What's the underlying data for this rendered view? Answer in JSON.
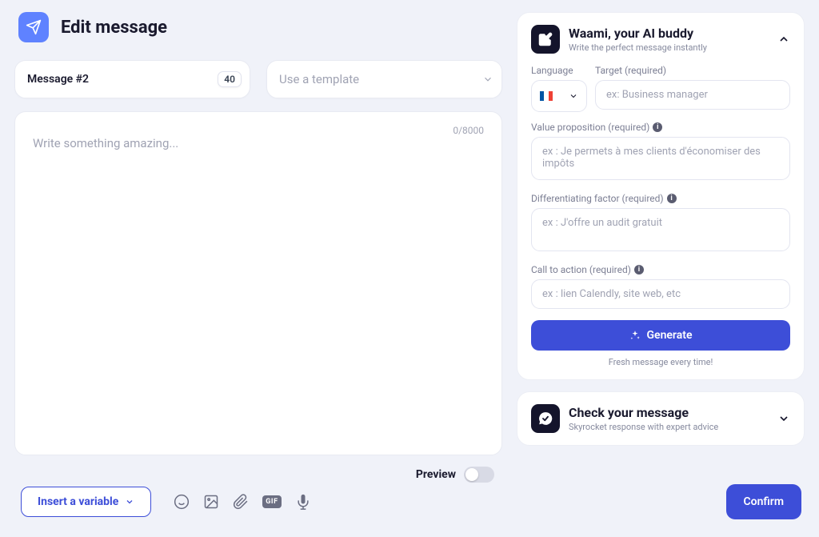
{
  "header": {
    "title": "Edit message"
  },
  "message": {
    "title": "Message #2",
    "badge": "40"
  },
  "template": {
    "placeholder": "Use a template"
  },
  "editor": {
    "placeholder": "Write something amazing...",
    "char_count": "0/8000"
  },
  "preview": {
    "label": "Preview"
  },
  "toolbar": {
    "insert_variable": "Insert a variable",
    "gif_label": "GIF"
  },
  "confirm_label": "Confirm",
  "waami": {
    "title": "Waami, your AI buddy",
    "subtitle": "Write the perfect message instantly",
    "language": {
      "label": "Language",
      "selected_flag": "fr"
    },
    "target": {
      "label": "Target (required)",
      "placeholder": "ex: Business manager"
    },
    "value_prop": {
      "label": "Value proposition (required)",
      "placeholder": "ex : Je permets à mes clients d'économiser des impôts"
    },
    "diff": {
      "label": "Differentiating factor (required)",
      "placeholder": "ex : J'offre un audit gratuit"
    },
    "cta": {
      "label": "Call to action (required)",
      "placeholder": "ex : lien Calendly, site web, etc"
    },
    "generate_label": "Generate",
    "fresh_text": "Fresh message every time!"
  },
  "check": {
    "title": "Check your message",
    "subtitle": "Skyrocket response with expert advice"
  }
}
